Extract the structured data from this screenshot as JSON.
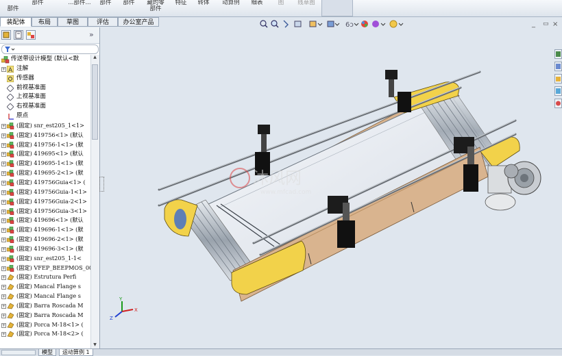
{
  "ribbon": {
    "buttons": [
      {
        "label": "\n部件"
      },
      {
        "label": "部件"
      },
      {
        "label": "...部件..."
      },
      {
        "label": "部件"
      },
      {
        "label": "部件"
      },
      {
        "label": "藏的零\n部件"
      },
      {
        "label": "特征"
      },
      {
        "label": "转体"
      },
      {
        "label": "动算例"
      },
      {
        "label": "细表"
      },
      {
        "label": "图"
      },
      {
        "label": "线草图"
      }
    ]
  },
  "tabs": [
    "装配体",
    "布局",
    "草图",
    "评估",
    "办公室产品"
  ],
  "tree": {
    "root": "传送带设计模型  (默认<默",
    "items": [
      {
        "icon": "annotation",
        "label": "注解",
        "expand": "+"
      },
      {
        "icon": "sensor",
        "label": "传感器",
        "expand": ""
      },
      {
        "icon": "plane",
        "label": "前视基准面",
        "expand": ""
      },
      {
        "icon": "plane",
        "label": "上视基准面",
        "expand": ""
      },
      {
        "icon": "plane",
        "label": "右视基准面",
        "expand": ""
      },
      {
        "icon": "origin",
        "label": "原点",
        "expand": ""
      },
      {
        "icon": "part",
        "label": "(固定) snr_est205_1<1>",
        "expand": "+"
      },
      {
        "icon": "part",
        "label": "(固定) 419756<1> (默认",
        "expand": "+"
      },
      {
        "icon": "part",
        "label": "(固定) 419756-1<1> (默",
        "expand": "+"
      },
      {
        "icon": "part",
        "label": "(固定) 419695<1> (默认",
        "expand": "+"
      },
      {
        "icon": "part",
        "label": "(固定) 419695-1<1> (默",
        "expand": "+"
      },
      {
        "icon": "part",
        "label": "(固定) 419695-2<1> (默",
        "expand": "+"
      },
      {
        "icon": "part",
        "label": "(固定) 419756Guia<1> (",
        "expand": "+"
      },
      {
        "icon": "part",
        "label": "(固定) 419756Guia-1<1>",
        "expand": "+"
      },
      {
        "icon": "part",
        "label": "(固定) 419756Guia-2<1>",
        "expand": "+"
      },
      {
        "icon": "part",
        "label": "(固定) 419756Guia-3<1>",
        "expand": "+"
      },
      {
        "icon": "part",
        "label": "(固定) 419696<1> (默认",
        "expand": "+"
      },
      {
        "icon": "part",
        "label": "(固定) 419696-1<1> (默",
        "expand": "+"
      },
      {
        "icon": "part",
        "label": "(固定) 419696-2<1> (默",
        "expand": "+"
      },
      {
        "icon": "part",
        "label": "(固定) 419696-3<1> (默",
        "expand": "+"
      },
      {
        "icon": "part",
        "label": "(固定) snr_est205_1-1<",
        "expand": "+"
      },
      {
        "icon": "part",
        "label": "(固定) VFEP_BEEPMOS_00",
        "expand": "+"
      },
      {
        "icon": "part2",
        "label": "(固定) Estrutura Perfi",
        "expand": "+"
      },
      {
        "icon": "part2",
        "label": "(固定) Mancal Flange s",
        "expand": "+"
      },
      {
        "icon": "part2",
        "label": "(固定) Mancal Flange s",
        "expand": "+"
      },
      {
        "icon": "part2",
        "label": "(固定) Barra Roscada M",
        "expand": "+"
      },
      {
        "icon": "part2",
        "label": "(固定) Barra Roscada M",
        "expand": "+"
      },
      {
        "icon": "part2",
        "label": "(固定) Porca M-18<1> (",
        "expand": "+"
      },
      {
        "icon": "part2",
        "label": "(固定) Porca M-18<2> (",
        "expand": "+"
      }
    ]
  },
  "watermark": {
    "main": "沐风网",
    "sub": "www.mfcad.com"
  },
  "bottom_tabs": [
    "模型",
    "运动算例 1"
  ],
  "colors": {
    "belt_frame": "#f2d24a",
    "side_rail": "#d9b48f",
    "belt": "#e9edf2"
  }
}
